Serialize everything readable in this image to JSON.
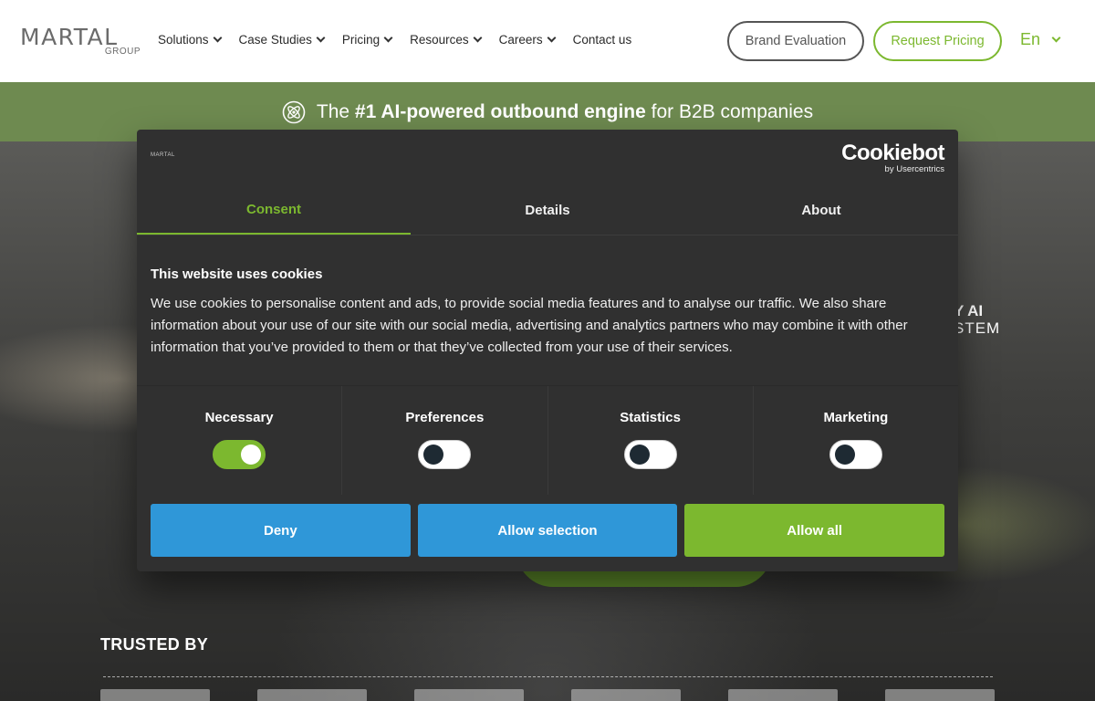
{
  "header": {
    "logo_main": "MARTAL",
    "logo_sub": "GROUP",
    "nav": [
      {
        "label": "Solutions",
        "has_dropdown": true
      },
      {
        "label": "Case Studies",
        "has_dropdown": true
      },
      {
        "label": "Pricing",
        "has_dropdown": true
      },
      {
        "label": "Resources",
        "has_dropdown": true
      },
      {
        "label": "Careers",
        "has_dropdown": true
      },
      {
        "label": "Contact us",
        "has_dropdown": false
      }
    ],
    "brand_evaluation": "Brand Evaluation",
    "request_pricing": "Request Pricing",
    "language": "En"
  },
  "banner": {
    "prefix": "The",
    "highlight": "#1 AI-powered outbound engine",
    "suffix": "for B2B companies",
    "icon": "atom-icon"
  },
  "hero": {
    "partial_text_1": "Y AI",
    "partial_text_2": "STEM",
    "trusted_by": "TRUSTED BY"
  },
  "dialog": {
    "logo": "MARTAL",
    "cookiebot_name": "Cookiebot",
    "cookiebot_by": "by Usercentrics",
    "tabs": [
      {
        "label": "Consent",
        "active": true
      },
      {
        "label": "Details",
        "active": false
      },
      {
        "label": "About",
        "active": false
      }
    ],
    "title": "This website uses cookies",
    "body": "We use cookies to personalise content and ads, to provide social media features and to analyse our traffic. We also share information about your use of our site with our social media, advertising and analytics partners who may combine it with other information that you’ve provided to them or that they’ve collected from your use of their services.",
    "toggles": [
      {
        "label": "Necessary",
        "on": true
      },
      {
        "label": "Preferences",
        "on": false
      },
      {
        "label": "Statistics",
        "on": false
      },
      {
        "label": "Marketing",
        "on": false
      }
    ],
    "buttons": {
      "deny": "Deny",
      "allow_selection": "Allow selection",
      "allow_all": "Allow all"
    }
  },
  "colors": {
    "accent_green": "#7cb82f",
    "accent_blue": "#2f97d8",
    "dialog_bg": "#303030",
    "banner_bg": "#6e8a50"
  }
}
